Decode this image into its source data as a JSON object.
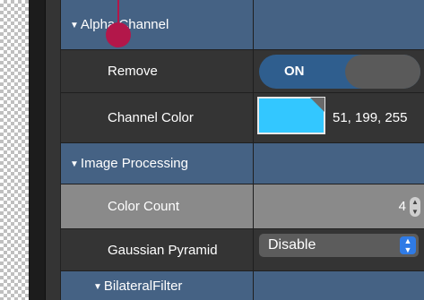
{
  "alpha_channel": {
    "label": "Alpha Channel"
  },
  "remove": {
    "label": "Remove",
    "value": "ON"
  },
  "channel_color": {
    "label": "Channel Color",
    "value": "51, 199, 255",
    "color": "#33c7ff"
  },
  "image_processing": {
    "label": "Image Processing"
  },
  "color_count": {
    "label": "Color Count",
    "value": "4"
  },
  "gaussian_pyramid": {
    "label": "Gaussian Pyramid",
    "value": "Disable"
  },
  "bilateral_filter": {
    "label": "BilateralFilter"
  },
  "colors": {
    "section": "#456284",
    "toggle_on": "#2f5e8e",
    "highlight_row": "#8a8a8a",
    "cursor": "#b3174a"
  }
}
